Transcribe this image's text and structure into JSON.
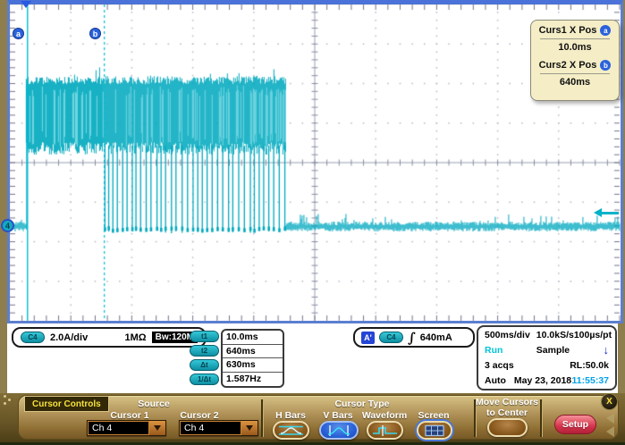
{
  "colors": {
    "trace": "#00a9bf",
    "trace_light": "#8adeea",
    "cursor": "#00bcd4",
    "run_text": "#00c3d6",
    "time_text": "#00a2e8",
    "selected_blue": "#2a62dc"
  },
  "scope": {
    "marker_a": "a",
    "marker_b": "b",
    "channel_marker": "4",
    "cursor_readout": {
      "curs1_label": "Curs1 X Pos",
      "curs1_value": "10.0ms",
      "curs2_label": "Curs2 X Pos",
      "curs2_value": "640ms"
    }
  },
  "status": {
    "channel": {
      "badge": "C4",
      "scale": "2.0A/div",
      "impedance": "1MΩ",
      "bandwidth": "Bw:120M"
    },
    "measurements": [
      {
        "badge": "t1",
        "value": "10.0ms"
      },
      {
        "badge": "t2",
        "value": "640ms"
      },
      {
        "badge": "Δt",
        "value": "630ms"
      },
      {
        "badge": "1/Δt",
        "value": "1.587Hz"
      }
    ],
    "trigger": {
      "source_badge": "A'",
      "channel_badge": "C4",
      "slope_icon": "∫",
      "level": "640mA"
    },
    "acquisition": {
      "timebase": "500ms/div",
      "sample_rate": "10.0kS/s",
      "resolution": "100µs/pt",
      "run_state": "Run",
      "mode": "Sample",
      "arrow_icon": "↓",
      "acqs": "3 acqs",
      "record_length": "RL:50.0k",
      "trigger_mode": "Auto",
      "date": "May 23, 2018",
      "time": "11:55:37"
    }
  },
  "menu": {
    "title": "Cursor Controls",
    "source_label": "Source",
    "cursor1_label": "Cursor 1",
    "cursor1_value": "Ch 4",
    "cursor2_label": "Cursor 2",
    "cursor2_value": "Ch 4",
    "cursor_type_label": "Cursor Type",
    "type_buttons": [
      {
        "label": "H Bars",
        "selected": false
      },
      {
        "label": "V Bars",
        "selected": true
      },
      {
        "label": "Waveform",
        "selected": false
      },
      {
        "label": "Screen",
        "selected": false
      }
    ],
    "move_cursors_label_1": "Move Cursors",
    "move_cursors_label_2": "to Center",
    "setup_label": "Setup",
    "close_label": "X"
  },
  "chart_data": {
    "type": "line",
    "instrument": "oscilloscope-trace",
    "channel": "Ch 4",
    "vertical_scale_A_per_div": 2.0,
    "horizontal_scale_ms_per_div": 500,
    "x_window_ms": [
      -135,
      4870
    ],
    "grid": {
      "h_divisions": 10,
      "v_divisions": 8
    },
    "trigger": {
      "level_A": 0.64,
      "position_ms": 0,
      "slope": "rising"
    },
    "cursors": {
      "a_ms": 10,
      "b_ms": 640,
      "delta_ms": 630,
      "inv_delta_hz": 1.587
    },
    "segments": [
      {
        "kind": "baseline",
        "t_ms": [
          -135,
          0
        ],
        "level_A": 0,
        "noise_A": 0.2
      },
      {
        "kind": "noise_band",
        "t_ms": [
          0,
          630
        ],
        "low_A": 4.2,
        "high_A": 7.4
      },
      {
        "kind": "noise_band_dropouts",
        "t_ms": [
          630,
          2130
        ],
        "low_A": 4.2,
        "high_A": 7.4,
        "dropout_level_A": 0,
        "dropout_spacing_ms": 40
      },
      {
        "kind": "baseline",
        "t_ms": [
          2130,
          4870
        ],
        "level_A": 0,
        "noise_A": 0.25
      }
    ]
  }
}
